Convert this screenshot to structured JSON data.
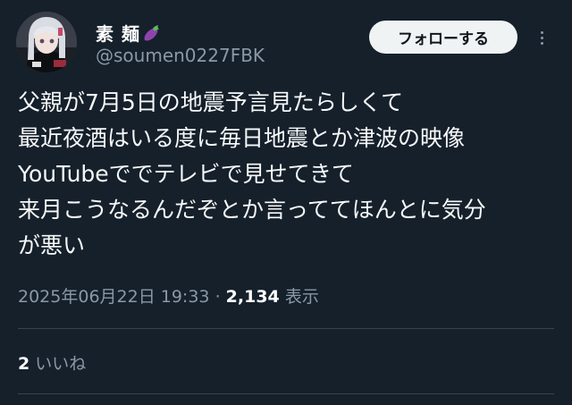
{
  "author": {
    "display_name": "素 麺",
    "name_emoji": "eggplant-emoji",
    "handle": "@soumen0227FBK",
    "avatar": "anime-character-avatar"
  },
  "actions": {
    "follow_label": "フォローする",
    "more_icon": "more-vertical-icon"
  },
  "tweet": {
    "lines": [
      "父親が7月5日の地震予言見たらしくて",
      "最近夜酒はいる度に毎日地震とか津波の映像",
      "YouTubeででテレビで見せてきて",
      "来月こうなるんだぞとか言っててほんとに気分",
      "が悪い"
    ]
  },
  "meta": {
    "timestamp": "2025年06月22日 19:33",
    "separator": "·",
    "view_count": "2,134",
    "view_label": "表示"
  },
  "engagement": {
    "like_count": "2",
    "like_label": "いいね"
  },
  "colors": {
    "background": "#15202b",
    "text": "#f7f9f9",
    "secondary_text": "#8b98a5",
    "divider": "#38444d",
    "follow_button_bg": "#eff3f4"
  }
}
